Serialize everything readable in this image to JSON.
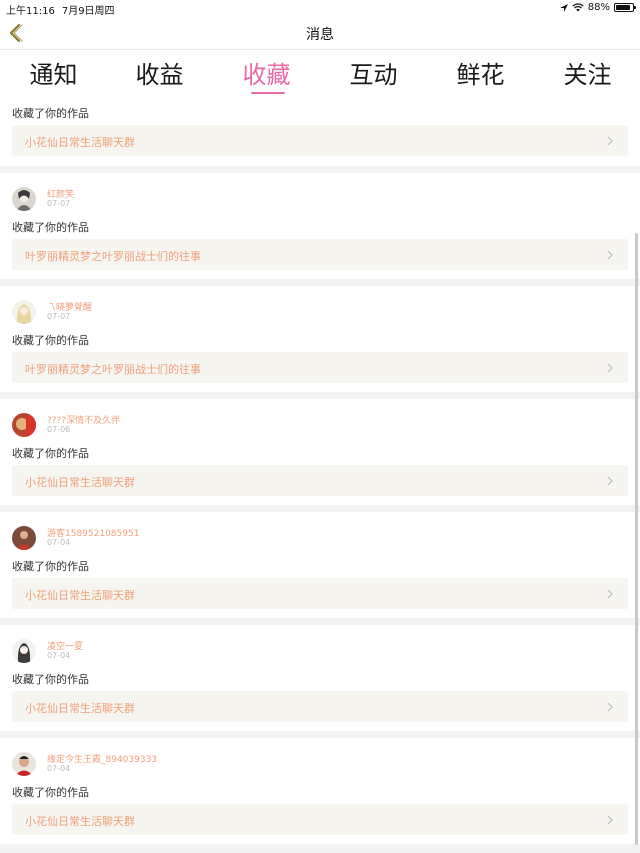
{
  "status_bar": {
    "time": "上午11:16",
    "date": "7月9日周四",
    "battery": "88%",
    "battery_level": 0.88
  },
  "nav": {
    "title": "消息"
  },
  "tabs": [
    {
      "label": "通知",
      "active": false
    },
    {
      "label": "收益",
      "active": false
    },
    {
      "label": "收藏",
      "active": true
    },
    {
      "label": "互动",
      "active": false
    },
    {
      "label": "鲜花",
      "active": false
    },
    {
      "label": "关注",
      "active": false
    }
  ],
  "first_card": {
    "action": "收藏了你的作品",
    "work": "小花仙日常生活聊天群"
  },
  "items": [
    {
      "username": "红颜笑",
      "date": "07-07",
      "action": "收藏了你的作品",
      "work": "叶罗丽精灵梦之叶罗丽战士们的往事"
    },
    {
      "username": "乁晓夢覺醒",
      "date": "07-07",
      "action": "收藏了你的作品",
      "work": "叶罗丽精灵梦之叶罗丽战士们的往事"
    },
    {
      "username": "????深情不及久伴",
      "date": "07-06",
      "action": "收藏了你的作品",
      "work": "小花仙日常生活聊天群"
    },
    {
      "username": "游客1589521085951",
      "date": "07-04",
      "action": "收藏了你的作品",
      "work": "小花仙日常生活聊天群"
    },
    {
      "username": "凌空一夏",
      "date": "07-04",
      "action": "收藏了你的作品",
      "work": "小花仙日常生活聊天群"
    },
    {
      "username": "缘定今生王霞_894039333",
      "date": "07-04",
      "action": "收藏了你的作品",
      "work": "小花仙日常生活聊天群"
    }
  ],
  "colors": {
    "accent": "#e86aa6",
    "username": "#f0a07a",
    "link_bg": "#f6f5f0"
  }
}
